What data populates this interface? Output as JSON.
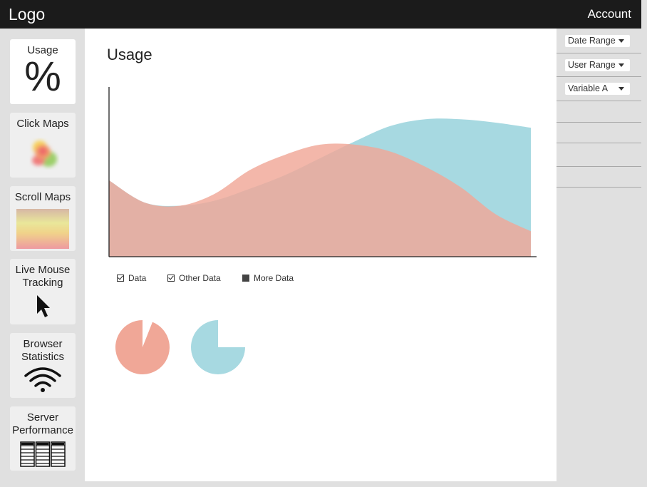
{
  "header": {
    "logo": "Logo",
    "account": "Account"
  },
  "sidebar": {
    "items": [
      {
        "label": "Usage",
        "glyph": "%",
        "icon": "percent-icon"
      },
      {
        "label": "Click Maps",
        "icon": "heatmap-blob-icon"
      },
      {
        "label": "Scroll Maps",
        "icon": "gradient-strip-icon"
      },
      {
        "label": "Live Mouse Tracking",
        "icon": "cursor-arrow-icon"
      },
      {
        "label": "Browser Statistics",
        "icon": "wifi-icon"
      },
      {
        "label": "Server Performance",
        "icon": "server-rack-icon"
      }
    ]
  },
  "main": {
    "title": "Usage"
  },
  "legend": [
    {
      "label": "Data",
      "state": "checked"
    },
    {
      "label": "Other Data",
      "state": "checked"
    },
    {
      "label": "More Data",
      "state": "filled"
    }
  ],
  "colors": {
    "salmon": "#f0a797",
    "teal": "#a7d9e1",
    "overlap": "#d9ad9e",
    "header": "#1b1b1b"
  },
  "chart_data": {
    "type": "area",
    "title": "",
    "xlabel": "",
    "ylabel": "",
    "x": [
      0,
      1,
      2,
      3,
      4,
      5,
      6,
      7,
      8,
      9,
      10,
      11,
      12
    ],
    "ylim": [
      0,
      100
    ],
    "grid": false,
    "series": [
      {
        "values": [
          45,
          32,
          30,
          33,
          40,
          48,
          58,
          68,
          77,
          81,
          81,
          79,
          76
        ]
      },
      {
        "values": [
          45,
          32,
          30,
          37,
          51,
          60,
          66,
          66,
          62,
          53,
          41,
          25,
          15
        ]
      }
    ]
  },
  "pies": [
    {
      "fill": 0.94,
      "color": "salmon"
    },
    {
      "fill": 0.75,
      "color": "teal"
    }
  ],
  "filters": [
    {
      "label": "Date Range"
    },
    {
      "label": "User Range"
    },
    {
      "label": "Variable A"
    }
  ]
}
